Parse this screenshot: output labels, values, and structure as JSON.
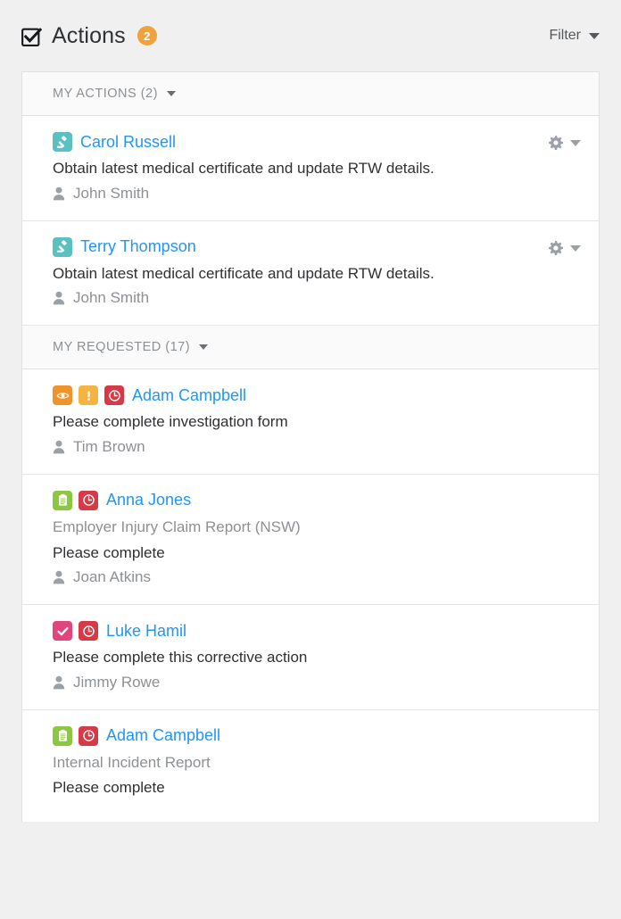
{
  "header": {
    "title": "Actions",
    "badge": "2",
    "checkbox_icon": "checkbox-checked-icon",
    "filter_label": "Filter",
    "filter_caret_icon": "chevron-down-icon"
  },
  "colors": {
    "page_background": "#f0f0f0",
    "card_background": "#ffffff",
    "accent_link": "#2196f3",
    "badge_orange": "#f0a33c",
    "muted_text": "#8d9094",
    "body_text": "#2e3033",
    "icon_teal": "#5bc0c0",
    "icon_orange": "#f0932b",
    "icon_yellow": "#f5b342",
    "icon_red": "#d63a46",
    "icon_green": "#8dc63f",
    "icon_pink": "#e0457b"
  },
  "sections": [
    {
      "label": "MY ACTIONS (2)",
      "caret_icon": "chevron-down-icon",
      "rows": [
        {
          "icons": [
            "gavel-icon"
          ],
          "person": "Carol Russell",
          "subtitle": "",
          "description": "Obtain latest medical certificate and update RTW details.",
          "assignee": "John Smith",
          "has_gear_menu": true
        },
        {
          "icons": [
            "gavel-icon"
          ],
          "person": "Terry Thompson",
          "subtitle": "",
          "description": "Obtain latest medical certificate and update RTW details.",
          "assignee": "John Smith",
          "has_gear_menu": true
        }
      ]
    },
    {
      "label": "MY REQUESTED (17)",
      "caret_icon": "chevron-down-icon",
      "rows": [
        {
          "icons": [
            "eye-icon",
            "exclamation-icon",
            "clock-icon"
          ],
          "person": "Adam Campbell",
          "subtitle": "",
          "description": "Please complete investigation form",
          "assignee": "Tim Brown",
          "has_gear_menu": false
        },
        {
          "icons": [
            "clipboard-icon",
            "clock-icon"
          ],
          "person": "Anna Jones",
          "subtitle": "Employer Injury Claim Report (NSW)",
          "description": "Please complete",
          "assignee": "Joan Atkins",
          "has_gear_menu": false
        },
        {
          "icons": [
            "check-icon",
            "clock-icon"
          ],
          "person": "Luke Hamil",
          "subtitle": "",
          "description": "Please complete this corrective action",
          "assignee": "Jimmy Rowe",
          "has_gear_menu": false
        },
        {
          "icons": [
            "clipboard-icon",
            "clock-icon"
          ],
          "person": "Adam Campbell",
          "subtitle": "Internal Incident Report",
          "description": "Please complete",
          "assignee": "",
          "has_gear_menu": false
        }
      ]
    }
  ]
}
